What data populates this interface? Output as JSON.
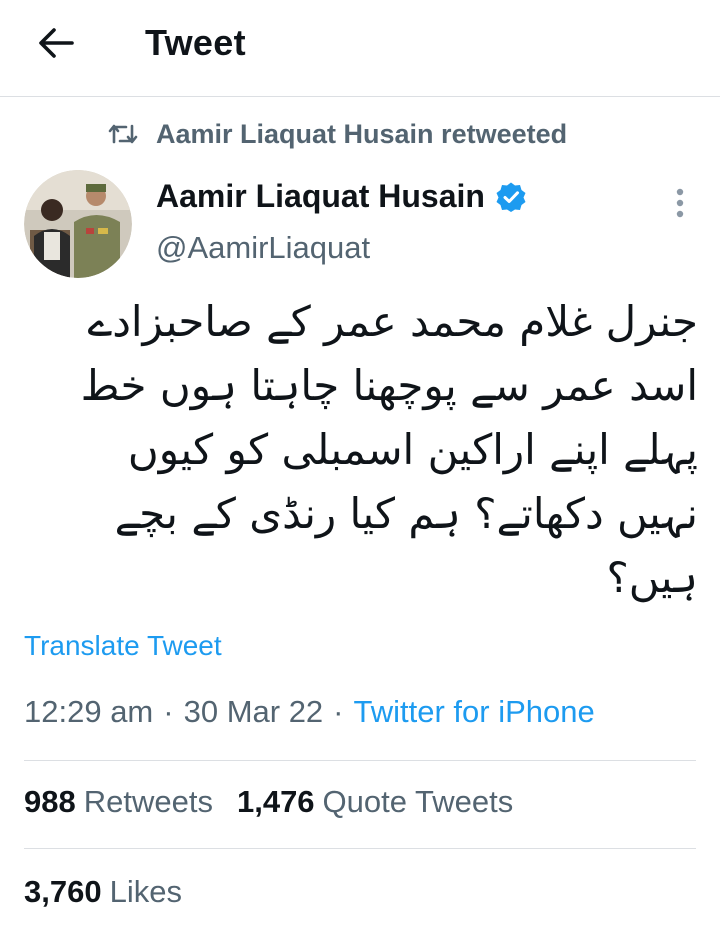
{
  "header": {
    "title": "Tweet",
    "back_icon": "arrow-left-icon"
  },
  "retweet_context": {
    "icon": "retweet-icon",
    "text": "Aamir Liaquat Husain retweeted"
  },
  "author": {
    "name": "Aamir Liaquat Husain",
    "handle": "@AamirLiaquat",
    "verified": true,
    "verified_color": "#1d9bf0"
  },
  "tweet": {
    "text_lines": [
      "جنرل غلام محمد عمر کے صاحبزادے",
      "اسد عمر سے پوچھنا چاہتا ہوں خط",
      "پہلے اپنے اراکین اسمبلی کو کیوں",
      "نہیں دکھاتے؟ ہم کیا رنڈی کے بچے",
      "ہیں؟"
    ],
    "translate_label": "Translate Tweet",
    "time": "12:29 am",
    "date": "30 Mar 22",
    "separator": "·",
    "source": "Twitter for iPhone"
  },
  "stats": {
    "retweets_count": "988",
    "retweets_label": "Retweets",
    "quote_count": "1,476",
    "quote_label": "Quote Tweets",
    "likes_count": "3,760",
    "likes_label": "Likes"
  },
  "colors": {
    "accent": "#1d9bf0",
    "secondary_text": "#536471",
    "primary_text": "#0f1419",
    "divider": "#dcdfe3"
  }
}
